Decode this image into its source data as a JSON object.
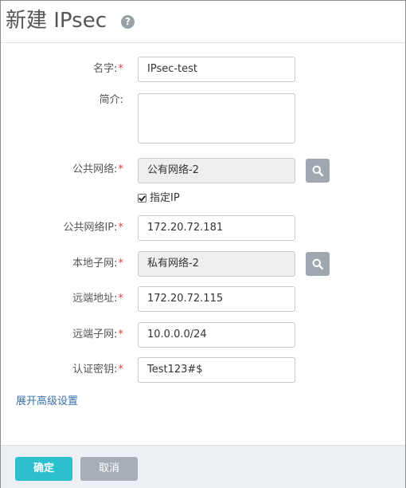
{
  "header": {
    "title": "新建 IPsec",
    "help_icon": "?"
  },
  "form": {
    "required_mark": "*",
    "name": {
      "label": "名字:",
      "value": "IPsec-test"
    },
    "description": {
      "label": "简介:",
      "value": ""
    },
    "public_network": {
      "label": "公共网络:",
      "value": "公有网络-2",
      "button_icon": "search-icon"
    },
    "specify_ip": {
      "label": "指定IP",
      "checked": true
    },
    "public_ip": {
      "label": "公共网络IP:",
      "value": "172.20.72.181"
    },
    "local_subnet": {
      "label": "本地子网:",
      "value": "私有网络-2",
      "button_icon": "search-icon"
    },
    "remote_address": {
      "label": "远端地址:",
      "value": "172.20.72.115"
    },
    "remote_subnet": {
      "label": "远端子网:",
      "value": "10.0.0.0/24"
    },
    "auth_key": {
      "label": "认证密钥:",
      "value": "Test123#$"
    },
    "advanced_link": "展开高级设置"
  },
  "footer": {
    "ok_label": "确定",
    "cancel_label": "取消"
  },
  "colors": {
    "primary": "#2cbfcc",
    "secondary": "#a7aeb6",
    "required": "#e23b3b",
    "link": "#3a6ea5"
  }
}
